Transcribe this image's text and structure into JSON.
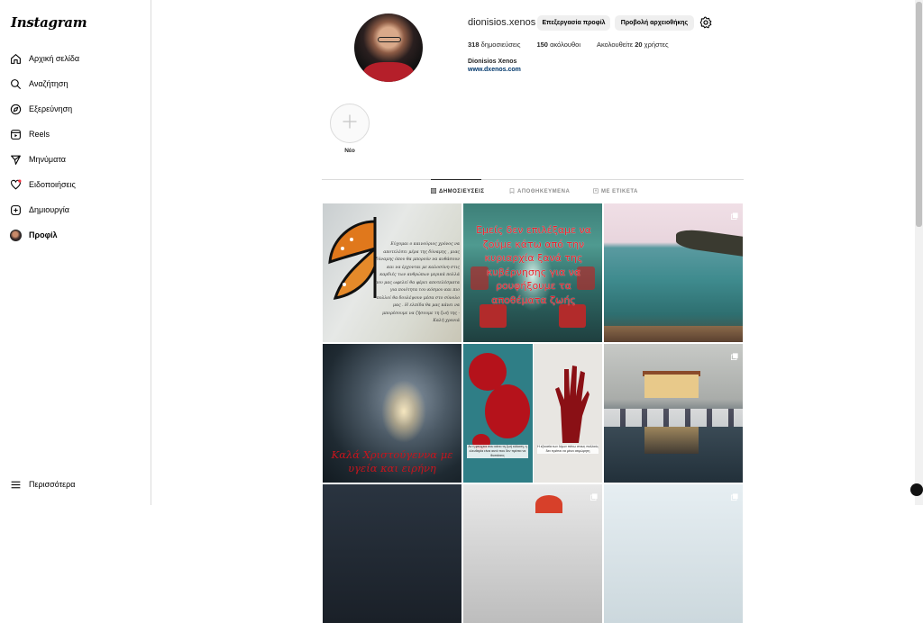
{
  "app": {
    "logo": "Instagram"
  },
  "sidebar": {
    "items": [
      {
        "label": "Αρχική σελίδα",
        "icon": "home-icon"
      },
      {
        "label": "Αναζήτηση",
        "icon": "search-icon"
      },
      {
        "label": "Εξερεύνηση",
        "icon": "compass-icon"
      },
      {
        "label": "Reels",
        "icon": "reels-icon"
      },
      {
        "label": "Μηνύματα",
        "icon": "send-icon"
      },
      {
        "label": "Ειδοποιήσεις",
        "icon": "heart-icon"
      },
      {
        "label": "Δημιουργία",
        "icon": "plus-square-icon"
      },
      {
        "label": "Προφίλ",
        "icon": "avatar"
      }
    ],
    "more": {
      "label": "Περισσότερα",
      "icon": "menu-icon"
    }
  },
  "profile": {
    "username": "dionisios.xenos",
    "edit_button": "Επεξεργασία προφίλ",
    "archive_button": "Προβολή αρχειοθήκης",
    "stats": {
      "posts_count": "318",
      "posts_label": "δημοσιεύσεις",
      "followers_count": "150",
      "followers_label": "ακόλουθοι",
      "following_prefix": "Ακολουθείτε",
      "following_count": "20",
      "following_suffix": "χρήστες"
    },
    "full_name": "Dionisios Xenos",
    "website": "www.dxenos.com"
  },
  "highlights": {
    "new_label": "Νέο"
  },
  "tabs": [
    {
      "label": "ΔΗΜΟΣΙΕΥΣΕΙΣ",
      "icon": "grid-icon",
      "active": true
    },
    {
      "label": "ΑΠΟΘΗΚΕΥΜΕΝΑ",
      "icon": "bookmark-icon",
      "active": false
    },
    {
      "label": "ΜΕ ΕΤΙΚΕΤΑ",
      "icon": "tag-icon",
      "active": false
    }
  ],
  "posts": {
    "post1_text": "Εύχομαι ο καινούριος χρόνος να αποτελέσει μέρα της δύναμης , μιας δύναμης όπου θα μπορούν να αυθάσουν και να έρχονται με καλοσύνη στις καρδιές των ανθρώπων μερικά πολλά που μας ωφελεί θα φέρει αποτελέσματα για ποιότητα του κόσμου και πιο πολλοί θα δουλέψουν μέσα στο σύνολο μας . Η ελπίδα θα μας κάνει να μπορέσουμε να ζήσουμε τη ζωή της - Καλή χρονιά",
    "post2_text": "Εμείς δεν επιλέξαμε να ζούμε κάτω από την κυριαρχία ξανά της κυβέρνησης για να ρουφήξουμε τα αποθέματα ζωής",
    "post4_text": "Καλά Χριστούγεννα με υγεία και ειρήνη",
    "post5_note_left": "Αν η φτώχεια σου κάνει τη ζωή κόλαση, η ελευθερία είναι αυτό που δεν πρέπει να θυσιάσεις",
    "post5_note_right": "Η εξουσία των λίγων πάνω στους πολλούς δεν πρέπει να μένει ατιμώρητη"
  }
}
